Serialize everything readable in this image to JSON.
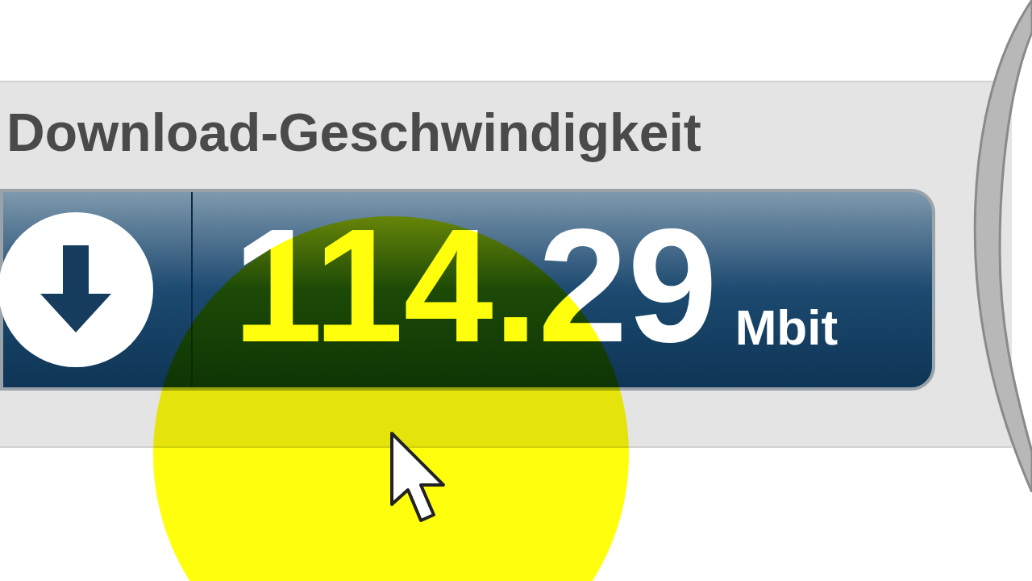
{
  "panel": {
    "title": "Download-Geschwindigkeit",
    "value": "114.29",
    "unit": "Mbit"
  }
}
